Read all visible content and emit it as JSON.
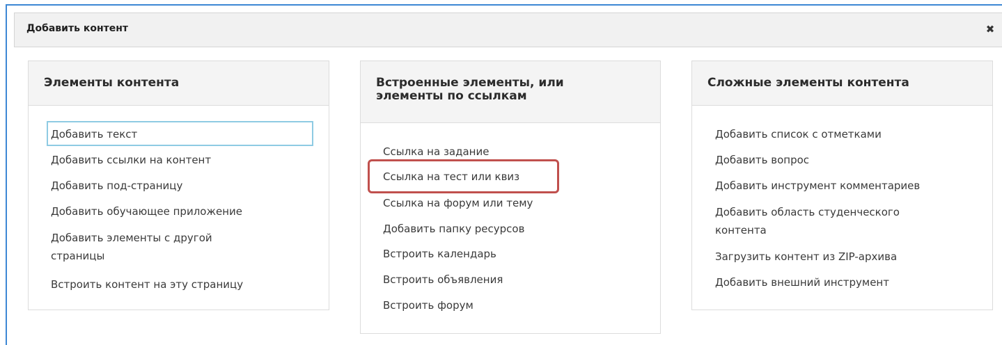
{
  "dialog": {
    "title": "Добавить контент",
    "close_icon": "close-icon",
    "close_glyph": "✖"
  },
  "panels": [
    {
      "title": "Элементы контента",
      "items": [
        "Добавить текст",
        "Добавить ссылки на контент",
        "Добавить под-страницу",
        "Добавить обучающее приложение",
        "Добавить элементы с другой страницы",
        "Встроить контент на эту страницу"
      ]
    },
    {
      "title": "Встроенные элементы, или элементы по ссылкам",
      "items": [
        "Ссылка на задание",
        "Ссылка на тест или квиз",
        "Ссылка на форум или тему",
        "Добавить папку ресурсов",
        "Встроить календарь",
        "Встроить объявления",
        "Встроить форум"
      ]
    },
    {
      "title": "Сложные элементы контента",
      "items": [
        "Добавить список с отметками",
        "Добавить вопрос",
        "Добавить инструмент комментариев",
        "Добавить область студенческого контента",
        "Загрузить контент из ZIP-архива",
        "Добавить внешний инструмент"
      ]
    }
  ],
  "colors": {
    "frame_border": "#3c87d4",
    "focus_outline": "#8ecbe3",
    "highlight_annotation": "#c0504d"
  }
}
